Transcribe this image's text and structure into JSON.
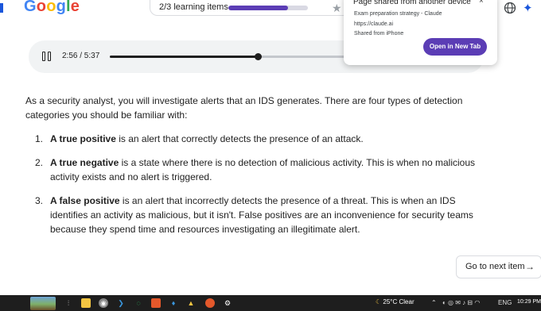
{
  "topbar": {
    "logo_letters": [
      "G",
      "o",
      "o",
      "g",
      "l",
      "e"
    ],
    "logo_colors": [
      "#4285F4",
      "#EA4335",
      "#FBBC05",
      "#4285F4",
      "#34A853",
      "#EA4335"
    ],
    "progress_text": "2/3 learning items",
    "progress_fraction": 0.75,
    "accent_color": "#5b3db5",
    "icons": [
      "star-icon",
      "globe-icon",
      "sparkle-icon"
    ]
  },
  "popup": {
    "title": "Page shared from another device",
    "close_glyph": "×",
    "page_title": "Exam preparation strategy - Claude",
    "url": "https://claude.ai",
    "source": "Shared from iPhone",
    "button_label": "Open in New Tab"
  },
  "player": {
    "state_icon": "pause-icon",
    "time_text": "2:56 / 5:37",
    "played_fraction": 0.62
  },
  "content": {
    "intro": "As a security analyst, you will investigate alerts that an IDS generates. There are four types of detection categories you should be familiar with:",
    "items": [
      {
        "num": "1.",
        "term": "A true positive",
        "rest": " is an alert that correctly detects the presence of an attack."
      },
      {
        "num": "2.",
        "term": "A true negative",
        "rest": " is a state where there is no detection of malicious activity. This is when no malicious activity exists and no alert is triggered."
      },
      {
        "num": "3.",
        "term": "A false positive",
        "rest": " is an alert that incorrectly detects the presence of a threat. This is when an IDS identifies an activity as malicious, but it isn't. False positives are an inconvenience for security teams because they spend time and resources investigating an illegitimate alert."
      }
    ]
  },
  "next": {
    "label": "Go to next item",
    "arrow": "→"
  },
  "taskbar": {
    "weather": "25°C  Clear",
    "language": "ENG",
    "clock": "10:29 PM"
  }
}
